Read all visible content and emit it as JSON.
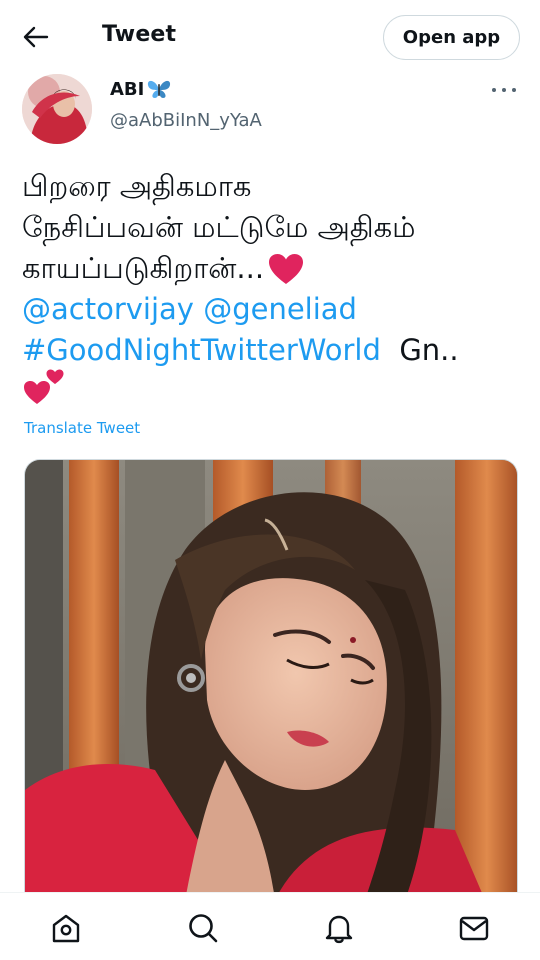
{
  "header": {
    "title": "Tweet",
    "open_app_label": "Open app",
    "back_icon": "arrow-left-icon"
  },
  "author": {
    "display_name": "ABI",
    "handle": "@aAbBiInN_yYaA",
    "name_emoji": "butterfly-icon",
    "more_icon": "more-horizontal-icon"
  },
  "tweet": {
    "line1": "பிறரை அதிகமாக",
    "line2": "நேசிப்பவன் மட்டுமே அதிகம்",
    "line3": "காயப்படுகிறான்...",
    "mention1": "@actorvijay",
    "mention2": "@geneliad",
    "hashtag": "#GoodNightTwitterWorld",
    "trailing_text": "Gn..",
    "translate_label": "Translate Tweet"
  },
  "colors": {
    "link": "#1d9bf0",
    "heart": "#e0245e",
    "text": "#0f1419",
    "secondary": "#536471"
  },
  "bottom_nav": {
    "items": [
      "home-icon",
      "search-icon",
      "notifications-icon",
      "messages-icon"
    ]
  }
}
